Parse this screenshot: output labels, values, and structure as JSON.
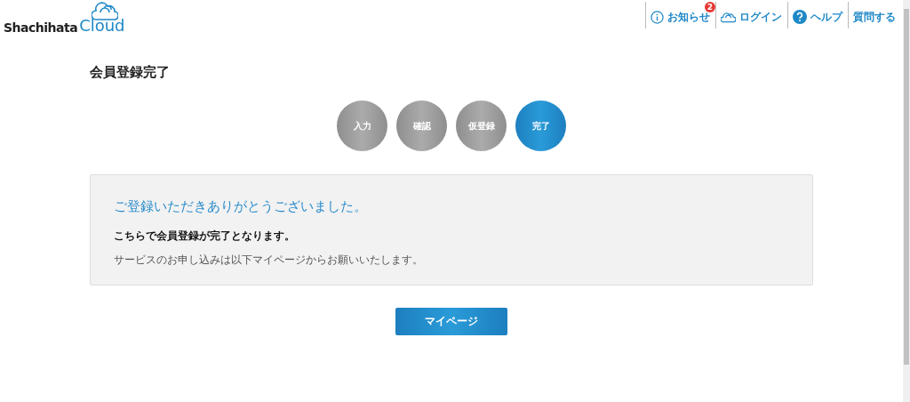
{
  "logo": {
    "brand": "Shachihata",
    "product": "Cloud"
  },
  "nav": [
    {
      "kind": "info",
      "label": "お知らせ",
      "badge": "2"
    },
    {
      "kind": "cloud",
      "label": "ログイン"
    },
    {
      "kind": "help",
      "label": "ヘルプ"
    },
    {
      "kind": "plain",
      "label": "質問する"
    }
  ],
  "page_title": "会員登録完了",
  "steps": [
    {
      "label": "入力",
      "selected": false
    },
    {
      "label": "確認",
      "selected": false
    },
    {
      "label": "仮登録",
      "selected": false
    },
    {
      "label": "完了",
      "selected": true
    }
  ],
  "message": {
    "heading": "ご登録いただきありがとうございました。",
    "body": "こちらで会員登録が完了となります。",
    "note": "サービスのお申し込みは以下マイページからお願いいたします。"
  },
  "button": "マイページ"
}
